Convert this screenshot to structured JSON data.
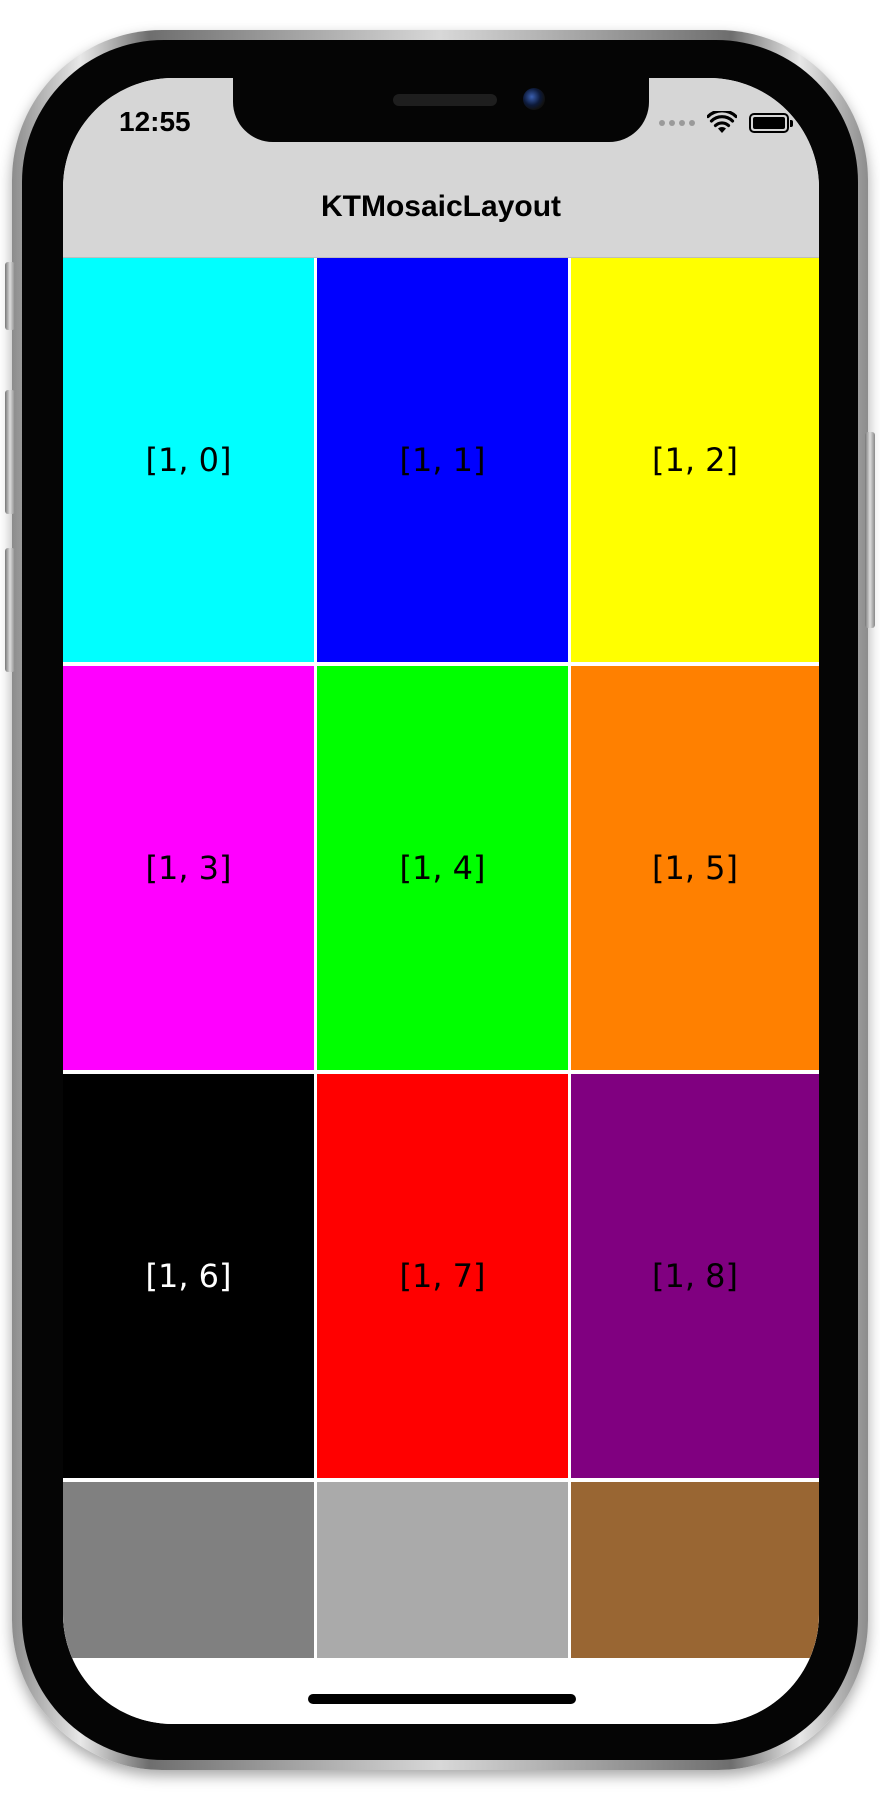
{
  "status_bar": {
    "time": "12:55",
    "icons": [
      "signal-dots-icon",
      "wifi-icon",
      "battery-icon"
    ]
  },
  "nav_bar": {
    "title": "KTMosaicLayout"
  },
  "cells": [
    {
      "label": "[1, 0]",
      "bg": "#00ffff",
      "fg": "#000000"
    },
    {
      "label": "[1, 1]",
      "bg": "#0000ff",
      "fg": "#000000"
    },
    {
      "label": "[1, 2]",
      "bg": "#ffff00",
      "fg": "#000000"
    },
    {
      "label": "[1, 3]",
      "bg": "#ff00ff",
      "fg": "#000000"
    },
    {
      "label": "[1, 4]",
      "bg": "#00ff00",
      "fg": "#000000"
    },
    {
      "label": "[1, 5]",
      "bg": "#ff8000",
      "fg": "#000000"
    },
    {
      "label": "[1, 6]",
      "bg": "#000000",
      "fg": "#ffffff"
    },
    {
      "label": "[1, 7]",
      "bg": "#ff0000",
      "fg": "#000000"
    },
    {
      "label": "[1, 8]",
      "bg": "#800080",
      "fg": "#000000"
    },
    {
      "label": "",
      "bg": "#808080",
      "fg": "#000000"
    },
    {
      "label": "",
      "bg": "#aaaaaa",
      "fg": "#000000"
    },
    {
      "label": "",
      "bg": "#996633",
      "fg": "#000000"
    }
  ],
  "colors": {
    "nav_background": "#d6d6d6",
    "grid_gap": "#ffffff"
  }
}
